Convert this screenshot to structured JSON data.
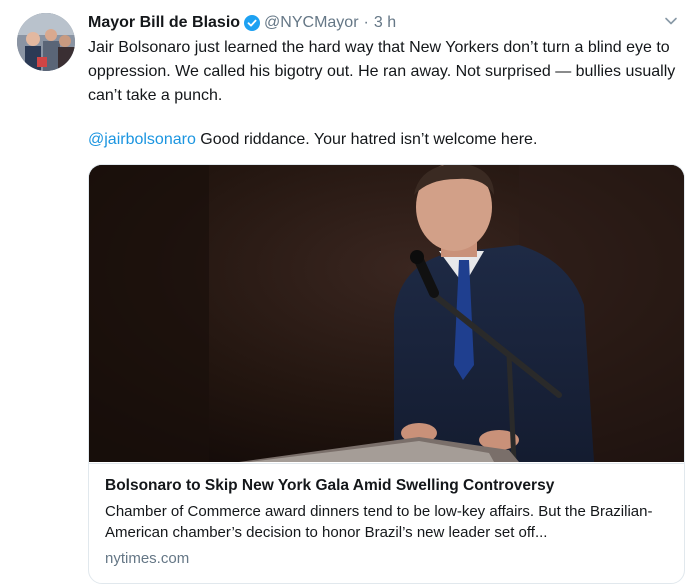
{
  "tweet": {
    "author_name": "Mayor Bill de Blasio",
    "handle": "@NYCMayor",
    "separator": "·",
    "time": "3 h",
    "body_paragraph": "Jair Bolsonaro just learned the hard way that New Yorkers don’t turn a blind eye to oppression. We called his bigotry out. He ran away. Not surprised — bullies usually can’t take a punch.",
    "mention": "@jairbolsonaro",
    "mention_followup": " Good riddance. Your hatred isn’t welcome here."
  },
  "card": {
    "title": "Bolsonaro to Skip New York Gala Amid Swelling Controversy",
    "description": "Chamber of Commerce award dinners tend to be low-key affairs. But the Brazilian-American chamber’s decision to honor Brazil’s new leader set off...",
    "domain": "nytimes.com"
  },
  "icons": {
    "verified": "verified-badge-icon",
    "menu": "chevron-down-icon"
  },
  "colors": {
    "link": "#1b95e0",
    "secondary_text": "#657786",
    "border": "#e1e8ed",
    "verified": "#1da1f2"
  }
}
